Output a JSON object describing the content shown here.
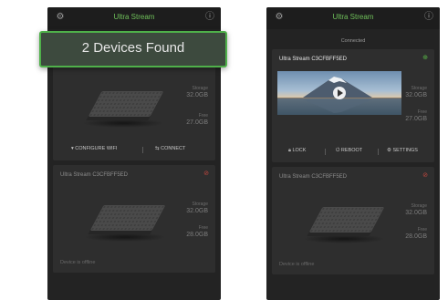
{
  "colors": {
    "accent": "#57b347",
    "alert": "#c0463e",
    "background": "#232323",
    "card": "#2e2e2e"
  },
  "toast": {
    "count": "2",
    "label": "Devices Found"
  },
  "left_phone": {
    "appbar": {
      "title": "Ultra Stream",
      "left_icon": "settings-icon",
      "right_icon": "info-icon"
    },
    "card1": {
      "stat_top": {
        "label": "Storage",
        "value": "32.0GB"
      },
      "stat_bottom": {
        "label": "Free",
        "value": "27.0GB"
      },
      "actions": [
        {
          "icon": "wifi-icon",
          "label": "CONFIGURE WIFI"
        },
        {
          "icon": "link-icon",
          "label": "CONNECT"
        }
      ]
    },
    "card2": {
      "title": "Ultra Stream C3CFBFF5ED",
      "status_icon": "unlink-icon",
      "stat_top": {
        "label": "Storage",
        "value": "32.0GB"
      },
      "stat_bottom": {
        "label": "Free",
        "value": "28.0GB"
      },
      "subtitle": "Device is offline"
    }
  },
  "right_phone": {
    "appbar": {
      "title": "Ultra Stream",
      "left_icon": "settings-icon",
      "right_icon": "info-icon"
    },
    "subtitle": "Connected",
    "card1": {
      "title": "Ultra Stream C3CFBFF5ED",
      "status_icon": "link-icon",
      "stat_top": {
        "label": "Storage",
        "value": "32.0GB"
      },
      "stat_bottom": {
        "label": "Free",
        "value": "27.0GB"
      },
      "actions": [
        {
          "icon": "lock-icon",
          "label": "LOCK"
        },
        {
          "icon": "power-icon",
          "label": "REBOOT"
        },
        {
          "icon": "gear-icon",
          "label": "SETTINGS"
        }
      ]
    },
    "card2": {
      "title": "Ultra Stream C3CFBFF5ED",
      "status_icon": "unlink-icon",
      "stat_top": {
        "label": "Storage",
        "value": "32.0GB"
      },
      "stat_bottom": {
        "label": "Free",
        "value": "28.0GB"
      },
      "subtitle": "Device is offline"
    }
  }
}
